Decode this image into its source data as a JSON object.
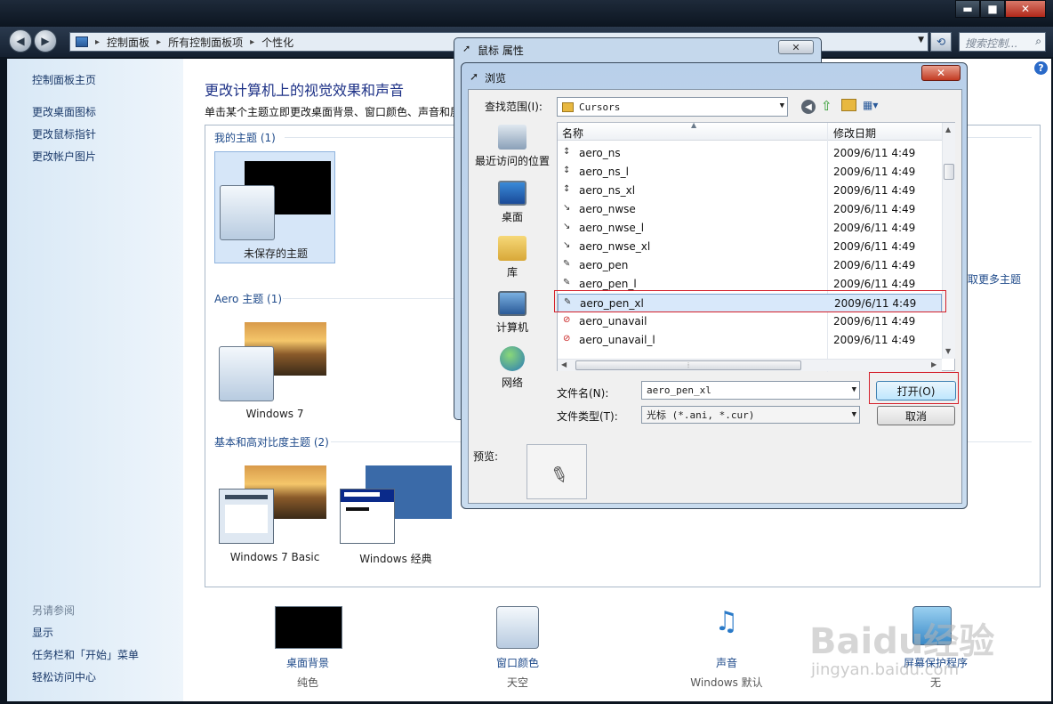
{
  "window": {
    "minimize": "▬",
    "maximize": "■",
    "close": "✕"
  },
  "navbar": {
    "breadcrumb": [
      "控制面板",
      "所有控制面板项",
      "个性化"
    ],
    "search_placeholder": "搜索控制..."
  },
  "sidebar": {
    "links": [
      "控制面板主页",
      "更改桌面图标",
      "更改鼠标指针",
      "更改帐户图片"
    ],
    "see_also_heading": "另请参阅",
    "see_also": [
      "显示",
      "任务栏和「开始」菜单",
      "轻松访问中心"
    ]
  },
  "main": {
    "title": "更改计算机上的视觉效果和声音",
    "subtitle": "单击某个主题立即更改桌面背景、窗口颜色、声音和屏",
    "groups": [
      {
        "heading": "我的主题 (1)",
        "themes": [
          "未保存的主题"
        ]
      },
      {
        "heading": "Aero 主题 (1)",
        "themes": [
          "Windows 7"
        ]
      },
      {
        "heading": "基本和高对比度主题 (2)",
        "themes": [
          "Windows 7 Basic",
          "Windows 经典"
        ]
      }
    ],
    "more_themes": "取更多主题"
  },
  "bottom": [
    {
      "label": "桌面背景",
      "sub": "纯色"
    },
    {
      "label": "窗口颜色",
      "sub": "天空"
    },
    {
      "label": "声音",
      "sub": "Windows 默认"
    },
    {
      "label": "屏幕保护程序",
      "sub": "无"
    }
  ],
  "mouse_dialog": {
    "title": "鼠标 属性",
    "close": "✕"
  },
  "browse_dialog": {
    "title": "浏览",
    "close": "✕",
    "look_in_label": "查找范围(I):",
    "look_in_value": "Cursors",
    "places": [
      "最近访问的位置",
      "桌面",
      "库",
      "计算机",
      "网络"
    ],
    "columns": {
      "name": "名称",
      "date": "修改日期"
    },
    "files": [
      {
        "name": "aero_ns",
        "date": "2009/6/11 4:49",
        "icon": "↕"
      },
      {
        "name": "aero_ns_l",
        "date": "2009/6/11 4:49",
        "icon": "↕"
      },
      {
        "name": "aero_ns_xl",
        "date": "2009/6/11 4:49",
        "icon": "↕"
      },
      {
        "name": "aero_nwse",
        "date": "2009/6/11 4:49",
        "icon": "↘"
      },
      {
        "name": "aero_nwse_l",
        "date": "2009/6/11 4:49",
        "icon": "↘"
      },
      {
        "name": "aero_nwse_xl",
        "date": "2009/6/11 4:49",
        "icon": "↘"
      },
      {
        "name": "aero_pen",
        "date": "2009/6/11 4:49",
        "icon": "✎"
      },
      {
        "name": "aero_pen_l",
        "date": "2009/6/11 4:49",
        "icon": "✎"
      },
      {
        "name": "aero_pen_xl",
        "date": "2009/6/11 4:49",
        "icon": "✎"
      },
      {
        "name": "aero_unavail",
        "date": "2009/6/11 4:49",
        "icon": "⊘"
      },
      {
        "name": "aero_unavail_l",
        "date": "2009/6/11 4:49",
        "icon": "⊘"
      }
    ],
    "selected_file": "aero_pen_xl",
    "filename_label": "文件名(N):",
    "filename_value": "aero_pen_xl",
    "filetype_label": "文件类型(T):",
    "filetype_value": "光标 (*.ani, *.cur)",
    "open_button": "打开(O)",
    "cancel_button": "取消",
    "preview_label": "预览:"
  },
  "watermark": {
    "text": "Baidu经验",
    "url": "jingyan.baidu.com"
  }
}
